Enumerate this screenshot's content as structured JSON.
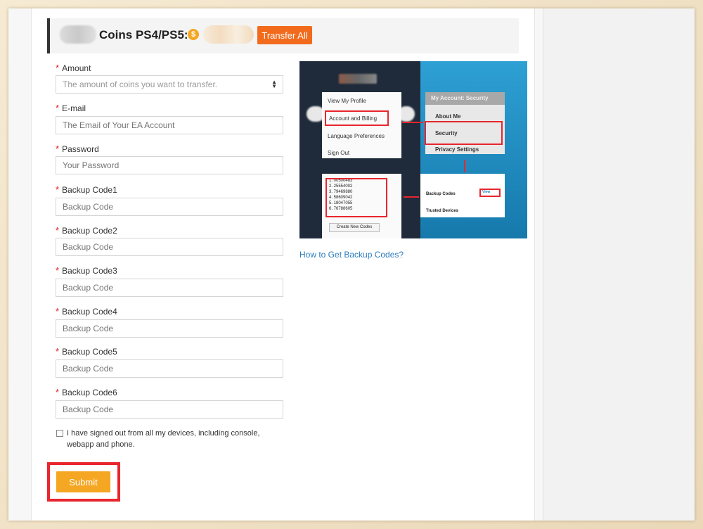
{
  "header": {
    "title": "Coins PS4/PS5:",
    "coin_symbol": "$",
    "transfer_all_label": "Transfer All"
  },
  "form": {
    "amount": {
      "label": "Amount",
      "placeholder": "The amount of coins you want to transfer."
    },
    "email": {
      "label": "E-mail",
      "placeholder": "The Email of Your EA Account"
    },
    "password": {
      "label": "Password",
      "placeholder": "Your Password"
    },
    "backup_codes": [
      {
        "label": "Backup Code1",
        "placeholder": "Backup Code"
      },
      {
        "label": "Backup Code2",
        "placeholder": "Backup Code"
      },
      {
        "label": "Backup Code3",
        "placeholder": "Backup Code"
      },
      {
        "label": "Backup Code4",
        "placeholder": "Backup Code"
      },
      {
        "label": "Backup Code5",
        "placeholder": "Backup Code"
      },
      {
        "label": "Backup Code6",
        "placeholder": "Backup Code"
      }
    ],
    "required_mark": "*",
    "signout_checkbox_label": "I have signed out from all my devices, including console, webapp and phone.",
    "signout_checked": false,
    "submit_label": "Submit"
  },
  "tutorial": {
    "menu_items": [
      "View My Profile",
      "Account and Billing",
      "Language Preferences",
      "Sign Out"
    ],
    "panel_title": "My Account: Security",
    "panel_items": [
      "About Me",
      "Security",
      "Privacy Settings"
    ],
    "codes": [
      "1. 00500483",
      "2. 25554002",
      "3. 79469880",
      "4. 58609042",
      "5. 18047055",
      "6. 76788605"
    ],
    "create_label": "Create New Codes",
    "backup_codes_label": "Backup Codes",
    "view_label": "View",
    "trusted_label": "Trusted Devices",
    "link_label": "How to Get Backup Codes?"
  },
  "colors": {
    "accent_orange": "#f26b1d",
    "submit_yellow": "#f5a623",
    "highlight_red": "#e8262e",
    "link_blue": "#2a7bbf"
  }
}
